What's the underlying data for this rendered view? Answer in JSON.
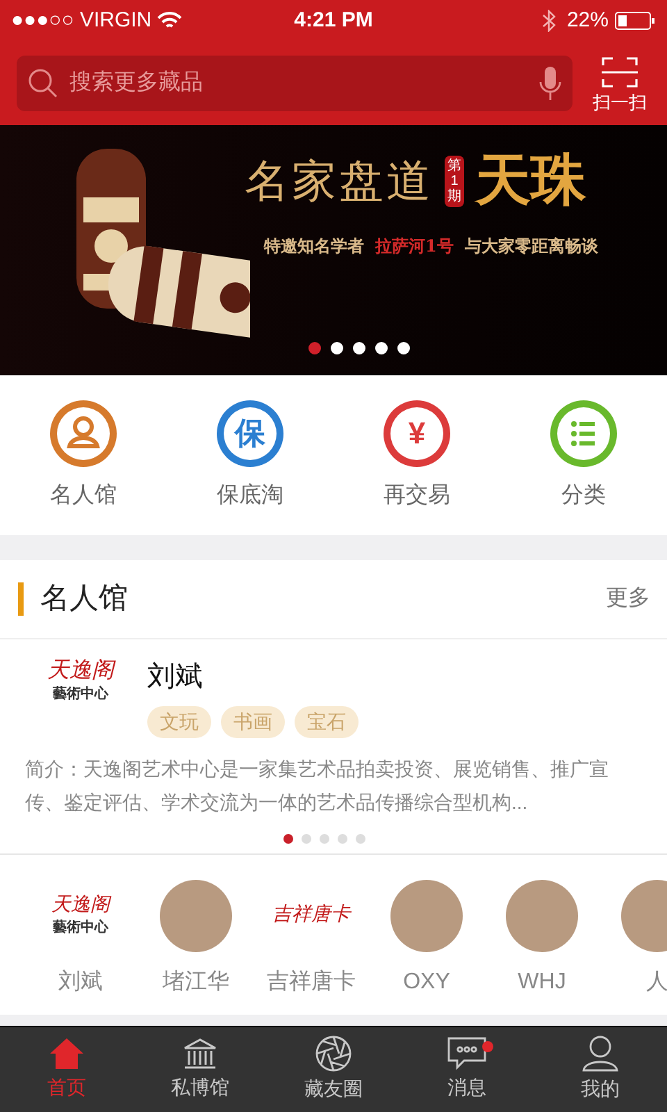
{
  "status_bar": {
    "carrier": "●●●○○ VIRGIN",
    "time": "4:21 PM",
    "battery": "22%"
  },
  "search": {
    "placeholder": "搜索更多藏品"
  },
  "scan_button": {
    "label": "扫一扫"
  },
  "banner": {
    "headline": "名家盘道",
    "issue": "第1期",
    "subject": "天珠",
    "tagline": [
      {
        "text": "特邀知名学者",
        "kind": "plain"
      },
      {
        "text": "拉萨河1号",
        "kind": "highlight"
      },
      {
        "text": "与大家零距离畅谈",
        "kind": "plain"
      }
    ],
    "dots": [
      {
        "selected": true
      },
      {
        "selected": false
      },
      {
        "selected": false
      },
      {
        "selected": false
      },
      {
        "selected": false
      }
    ]
  },
  "shortcuts": [
    {
      "label": "名人馆",
      "kind": "person",
      "color": "#d67a2c"
    },
    {
      "label": "保底淘",
      "kind": "glyph",
      "glyph": "保",
      "color": "#2b7fd1"
    },
    {
      "label": "再交易",
      "kind": "glyph",
      "glyph": "¥",
      "color": "#dc3b3b"
    },
    {
      "label": "分类",
      "kind": "list",
      "color": "#69b92c"
    }
  ],
  "section": {
    "title": "名人馆",
    "more": "更多"
  },
  "featured": {
    "logo_title": "天逸阁",
    "logo_subtitle": "藝術中心",
    "name": "刘斌",
    "tags": [
      "文玩",
      "书画",
      "宝石"
    ],
    "intro": "简介：天逸阁艺术中心是一家集艺术品拍卖投资、展览销售、推广宣传、鉴定评估、学术交流为一体的艺术品传播综合型机构...",
    "dots": [
      {
        "selected": true
      },
      {
        "selected": false
      },
      {
        "selected": false
      },
      {
        "selected": false
      },
      {
        "selected": false
      }
    ]
  },
  "people": [
    {
      "name": "刘斌",
      "kind": "logo",
      "logo_title": "天逸阁",
      "logo_subtitle": "藝術中心"
    },
    {
      "name": "堵江华",
      "kind": "photo"
    },
    {
      "name": "吉祥唐卡",
      "kind": "logo",
      "logo_title": "吉祥唐卡"
    },
    {
      "name": "OXY",
      "kind": "photo"
    },
    {
      "name": "WHJ",
      "kind": "photo"
    },
    {
      "name": "人",
      "kind": "photo"
    }
  ],
  "tab_bar": [
    {
      "label": "首页",
      "selected": true,
      "badge": false
    },
    {
      "label": "私博馆",
      "selected": false,
      "badge": false
    },
    {
      "label": "藏友圈",
      "selected": false,
      "badge": false
    },
    {
      "label": "消息",
      "selected": false,
      "badge": true
    },
    {
      "label": "我的",
      "selected": false,
      "badge": false
    }
  ]
}
